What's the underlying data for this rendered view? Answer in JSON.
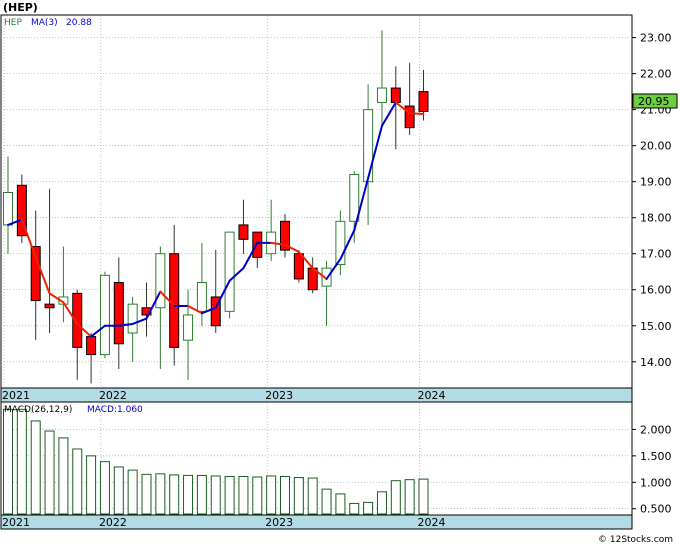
{
  "title": "(HEP)",
  "watermark": "© 12Stocks.com",
  "colors": {
    "up": "#2e7d32",
    "down": "#ff0000",
    "ma_up": "#0000cc",
    "ma_down": "#ee2200",
    "macd_bar": "#1b5e20",
    "axis_strip": "#b2dbe6",
    "grid": "#999999",
    "price_badge_bg": "#6dcf3f"
  },
  "price_panel": {
    "legend_ticker": "HEP",
    "legend_ma": "MA(3)",
    "legend_ma_value": "20.88",
    "last_price_label": "20.95",
    "last_price": 20.95,
    "y_ticks": [
      {
        "label": "23.00",
        "value": 23.0
      },
      {
        "label": "22.00",
        "value": 22.0
      },
      {
        "label": "21.00",
        "value": 21.0
      },
      {
        "label": "20.00",
        "value": 20.0
      },
      {
        "label": "19.00",
        "value": 19.0
      },
      {
        "label": "18.00",
        "value": 18.0
      },
      {
        "label": "17.00",
        "value": 17.0
      },
      {
        "label": "16.00",
        "value": 16.0
      },
      {
        "label": "15.00",
        "value": 15.0
      },
      {
        "label": "14.00",
        "value": 14.0
      }
    ],
    "x_labels": [
      {
        "label": "2021",
        "index": 0
      },
      {
        "label": "2022",
        "index": 7
      },
      {
        "label": "2023",
        "index": 19
      },
      {
        "label": "2024",
        "index": 30
      }
    ]
  },
  "macd_panel": {
    "legend_macd": "MACD(26,12,9)",
    "legend_value": "MACD:1.060",
    "y_ticks": [
      {
        "label": "2.000",
        "value": 2.0
      },
      {
        "label": "1.500",
        "value": 1.5
      },
      {
        "label": "1.000",
        "value": 1.0
      },
      {
        "label": "0.500",
        "value": 0.5
      }
    ],
    "x_labels": [
      {
        "label": "2021",
        "index": 0
      },
      {
        "label": "2022",
        "index": 7
      },
      {
        "label": "2023",
        "index": 19
      },
      {
        "label": "2024",
        "index": 30
      }
    ]
  },
  "chart_data": {
    "type": "candlestick",
    "period": "monthly",
    "ylim": [
      13.3,
      23.6
    ],
    "candles": [
      {
        "o": 17.8,
        "h": 19.7,
        "l": 17.0,
        "c": 18.7
      },
      {
        "o": 18.9,
        "h": 19.2,
        "l": 17.3,
        "c": 17.5
      },
      {
        "o": 17.2,
        "h": 18.2,
        "l": 14.6,
        "c": 15.7
      },
      {
        "o": 15.6,
        "h": 18.8,
        "l": 14.8,
        "c": 15.5
      },
      {
        "o": 15.6,
        "h": 17.2,
        "l": 15.1,
        "c": 15.8
      },
      {
        "o": 15.9,
        "h": 16.0,
        "l": 13.5,
        "c": 14.4
      },
      {
        "o": 14.7,
        "h": 14.8,
        "l": 13.4,
        "c": 14.2
      },
      {
        "o": 14.2,
        "h": 16.5,
        "l": 14.1,
        "c": 16.4
      },
      {
        "o": 16.2,
        "h": 16.9,
        "l": 13.8,
        "c": 14.5
      },
      {
        "o": 14.8,
        "h": 15.8,
        "l": 14.0,
        "c": 15.6
      },
      {
        "o": 15.5,
        "h": 16.2,
        "l": 14.7,
        "c": 15.3
      },
      {
        "o": 15.5,
        "h": 17.2,
        "l": 13.8,
        "c": 17.0
      },
      {
        "o": 17.0,
        "h": 17.8,
        "l": 13.9,
        "c": 14.4
      },
      {
        "o": 14.6,
        "h": 16.0,
        "l": 13.5,
        "c": 15.3
      },
      {
        "o": 15.4,
        "h": 17.3,
        "l": 15.0,
        "c": 16.2
      },
      {
        "o": 15.8,
        "h": 17.1,
        "l": 14.8,
        "c": 15.0
      },
      {
        "o": 15.4,
        "h": 17.6,
        "l": 15.2,
        "c": 17.6
      },
      {
        "o": 17.8,
        "h": 18.5,
        "l": 17.0,
        "c": 17.4
      },
      {
        "o": 17.6,
        "h": 17.6,
        "l": 16.6,
        "c": 16.9
      },
      {
        "o": 17.0,
        "h": 18.5,
        "l": 16.8,
        "c": 17.6
      },
      {
        "o": 17.9,
        "h": 18.1,
        "l": 16.9,
        "c": 17.1
      },
      {
        "o": 17.0,
        "h": 17.1,
        "l": 16.2,
        "c": 16.3
      },
      {
        "o": 16.6,
        "h": 16.9,
        "l": 15.9,
        "c": 16.0
      },
      {
        "o": 16.1,
        "h": 16.8,
        "l": 15.0,
        "c": 16.6
      },
      {
        "o": 16.7,
        "h": 18.2,
        "l": 16.4,
        "c": 17.9
      },
      {
        "o": 17.9,
        "h": 19.3,
        "l": 17.3,
        "c": 19.2
      },
      {
        "o": 19.0,
        "h": 21.7,
        "l": 17.8,
        "c": 21.0
      },
      {
        "o": 21.2,
        "h": 23.2,
        "l": 20.6,
        "c": 21.6
      },
      {
        "o": 21.6,
        "h": 22.2,
        "l": 19.9,
        "c": 21.2
      },
      {
        "o": 21.1,
        "h": 22.3,
        "l": 20.3,
        "c": 20.5
      },
      {
        "o": 21.5,
        "h": 22.1,
        "l": 20.7,
        "c": 20.95
      }
    ],
    "ma3": [
      17.8,
      17.95,
      16.9,
      15.9,
      15.65,
      15.05,
      14.7,
      15.0,
      15.0,
      15.05,
      15.2,
      15.95,
      15.55,
      15.55,
      15.35,
      15.5,
      16.25,
      16.6,
      17.3,
      17.3,
      17.25,
      17.05,
      16.6,
      16.3,
      16.85,
      17.65,
      19.1,
      20.55,
      21.2,
      20.9,
      20.88
    ],
    "macd": [
      2.38,
      2.38,
      2.16,
      1.97,
      1.84,
      1.63,
      1.5,
      1.39,
      1.29,
      1.23,
      1.15,
      1.16,
      1.14,
      1.13,
      1.13,
      1.12,
      1.11,
      1.11,
      1.1,
      1.12,
      1.11,
      1.09,
      1.08,
      0.87,
      0.78,
      0.6,
      0.62,
      0.82,
      1.03,
      1.05,
      1.06
    ],
    "macd_ylim": [
      0.4,
      2.5
    ]
  }
}
